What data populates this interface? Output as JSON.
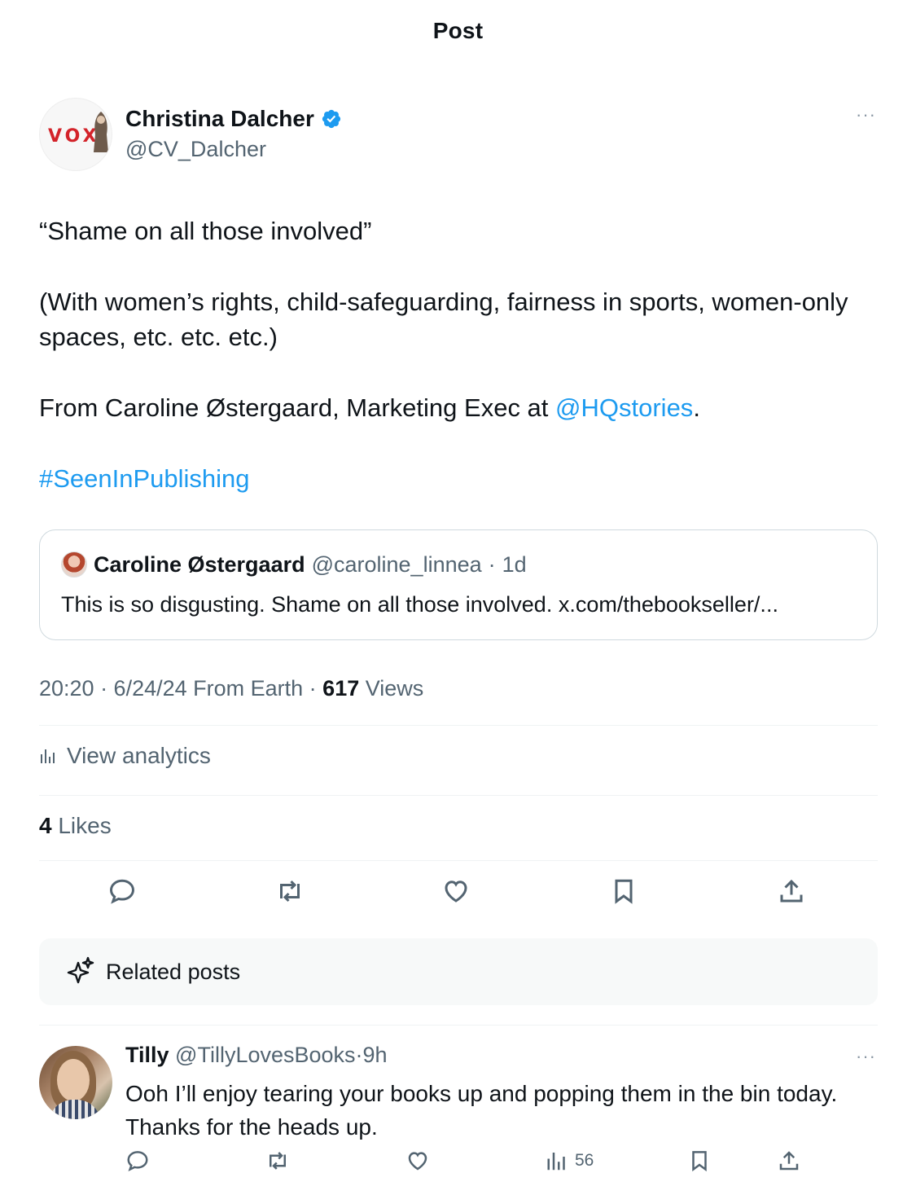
{
  "header": {
    "title": "Post"
  },
  "post": {
    "author_name": "Christina Dalcher",
    "author_handle": "@CV_Dalcher",
    "avatar_text": "VOX",
    "verified_icon": "verified-badge-icon",
    "more_icon": "···",
    "paragraph_1": "“Shame on all those involved”",
    "paragraph_2": "(With women’s rights, child-safeguarding, fairness in sports, women-only spaces, etc. etc. etc.)",
    "paragraph_3_prefix": "From Caroline Østergaard, Marketing Exec at ",
    "paragraph_3_link": "@HQstories",
    "paragraph_3_suffix": ".",
    "hashtag": "#SeenInPublishing",
    "timestamp": "20:20 · 6/24/24 From Earth · ",
    "views_count": "617",
    "views_label": " Views",
    "analytics_label": "View analytics",
    "likes_count": "4",
    "likes_label": " Likes"
  },
  "quote": {
    "name": "Caroline Østergaard",
    "handle": "@caroline_linnea",
    "dot": "·",
    "time": "1d",
    "text": "This is so disgusting. Shame on all those involved. x.com/thebookseller/..."
  },
  "related": {
    "label": "Related posts"
  },
  "reply": {
    "name": "Tilly",
    "handle": "@TillyLovesBooks",
    "dot": "·",
    "time": "9h",
    "text": "Ooh I’ll enjoy tearing your books up and popping them in the bin today. Thanks for the heads up.",
    "views": "56",
    "more_icon": "···"
  },
  "colors": {
    "link": "#1d9bf0",
    "muted": "#536471",
    "text": "#0f1419",
    "vox_red": "#d3232a"
  }
}
